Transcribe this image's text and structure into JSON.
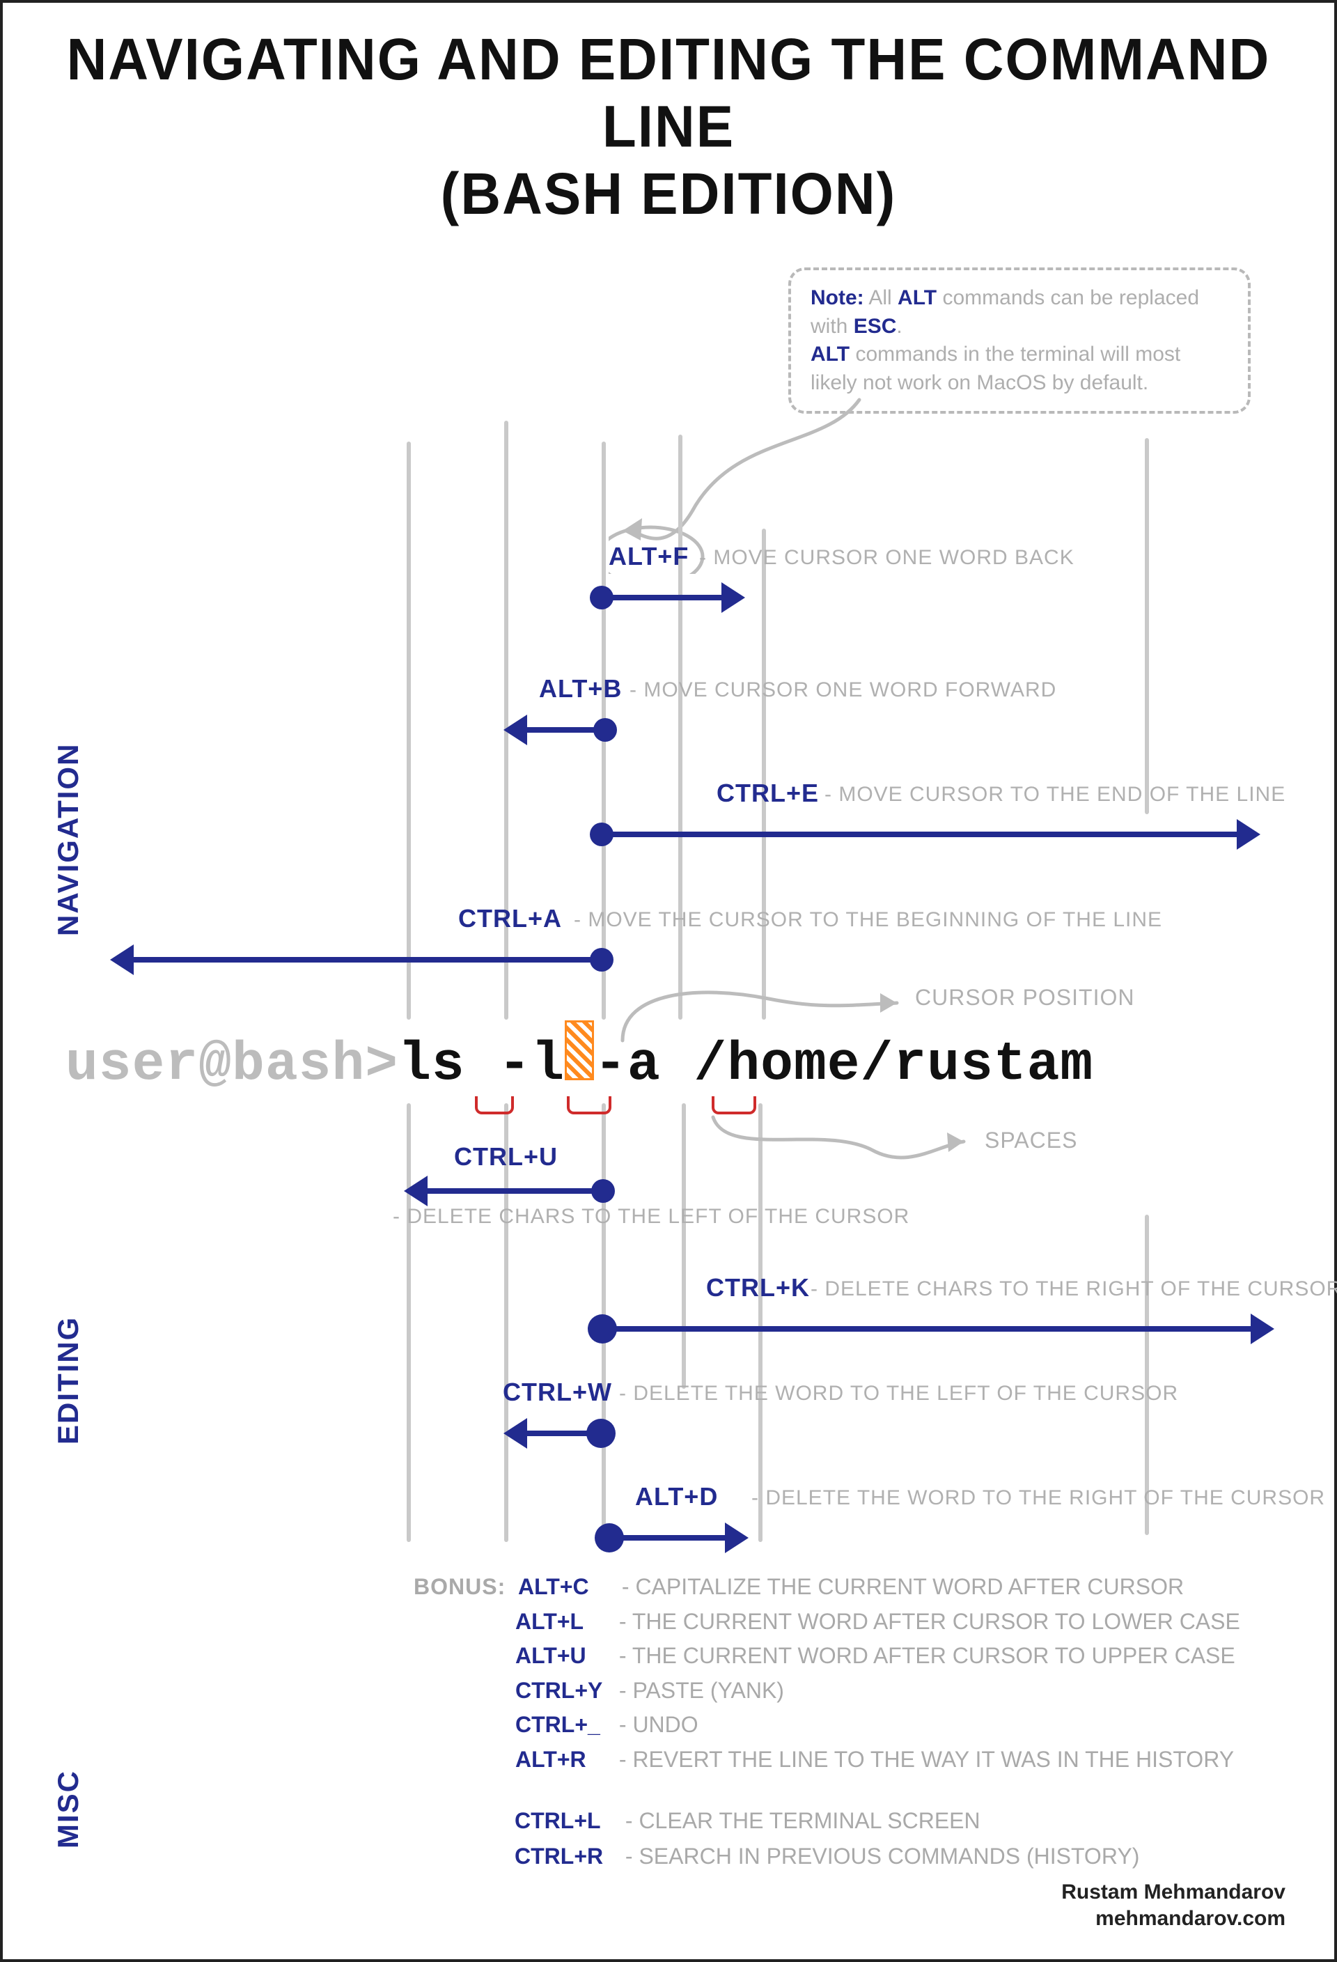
{
  "title_line1": "NAVIGATING AND EDITING THE COMMAND LINE",
  "title_line2": "(BASH EDITION)",
  "note": {
    "lead": "Note:",
    "text1a": "All ",
    "alt": "ALT",
    "text1b": " commands can be replaced with ",
    "esc": "ESC",
    "text1c": ".",
    "text2a": " commands in the terminal will most likely not work on MacOS by default."
  },
  "section_navigation": "NAVIGATION",
  "section_editing": "EDITING",
  "section_misc": "MISC",
  "nav": {
    "altf": {
      "key": "ALT+F",
      "desc": "- MOVE CURSOR ONE WORD BACK"
    },
    "altb": {
      "key": "ALT+B",
      "desc": "- MOVE CURSOR ONE WORD FORWARD"
    },
    "ctrle": {
      "key": "CTRL+E",
      "desc": "- MOVE CURSOR TO THE END OF THE LINE"
    },
    "ctrla": {
      "key": "CTRL+A",
      "desc": "- MOVE THE CURSOR TO THE BEGINNING OF THE LINE"
    }
  },
  "edit": {
    "ctrlu": {
      "key": "CTRL+U",
      "desc": "- DELETE CHARS TO THE LEFT OF THE CURSOR"
    },
    "ctrlk": {
      "key": "CTRL+K",
      "desc": "- DELETE CHARS TO THE RIGHT OF THE CURSOR"
    },
    "ctrlw": {
      "key": "CTRL+W",
      "desc": "- DELETE THE WORD TO THE LEFT OF THE CURSOR"
    },
    "altd": {
      "key": "ALT+D",
      "desc": "- DELETE THE WORD TO THE RIGHT OF THE CURSOR"
    }
  },
  "cli": {
    "prompt": "user@bash>",
    "pre": "ls -l",
    "post": "-a /home/rustam"
  },
  "labelCursor": "CURSOR POSITION",
  "labelSpaces": "SPACES",
  "bonus": {
    "lead": "BONUS:",
    "items": [
      {
        "key": "ALT+C",
        "desc": "- CAPITALIZE THE CURRENT WORD AFTER CURSOR"
      },
      {
        "key": "ALT+L",
        "desc": "- THE CURRENT WORD AFTER CURSOR TO LOWER CASE"
      },
      {
        "key": "ALT+U",
        "desc": "- THE CURRENT WORD AFTER CURSOR TO UPPER CASE"
      },
      {
        "key": "CTRL+Y",
        "desc": "- PASTE (YANK)"
      },
      {
        "key": "CTRL+_",
        "desc": "- UNDO"
      },
      {
        "key": "ALT+R",
        "desc": "- REVERT THE LINE TO THE WAY IT WAS IN THE HISTORY"
      }
    ]
  },
  "misc": {
    "items": [
      {
        "key": "CTRL+L",
        "desc": "- CLEAR THE TERMINAL SCREEN"
      },
      {
        "key": "CTRL+R",
        "desc": "- SEARCH IN PREVIOUS COMMANDS (HISTORY)"
      }
    ]
  },
  "credit": {
    "name": "Rustam Mehmandarov",
    "site": "mehmandarov.com"
  }
}
